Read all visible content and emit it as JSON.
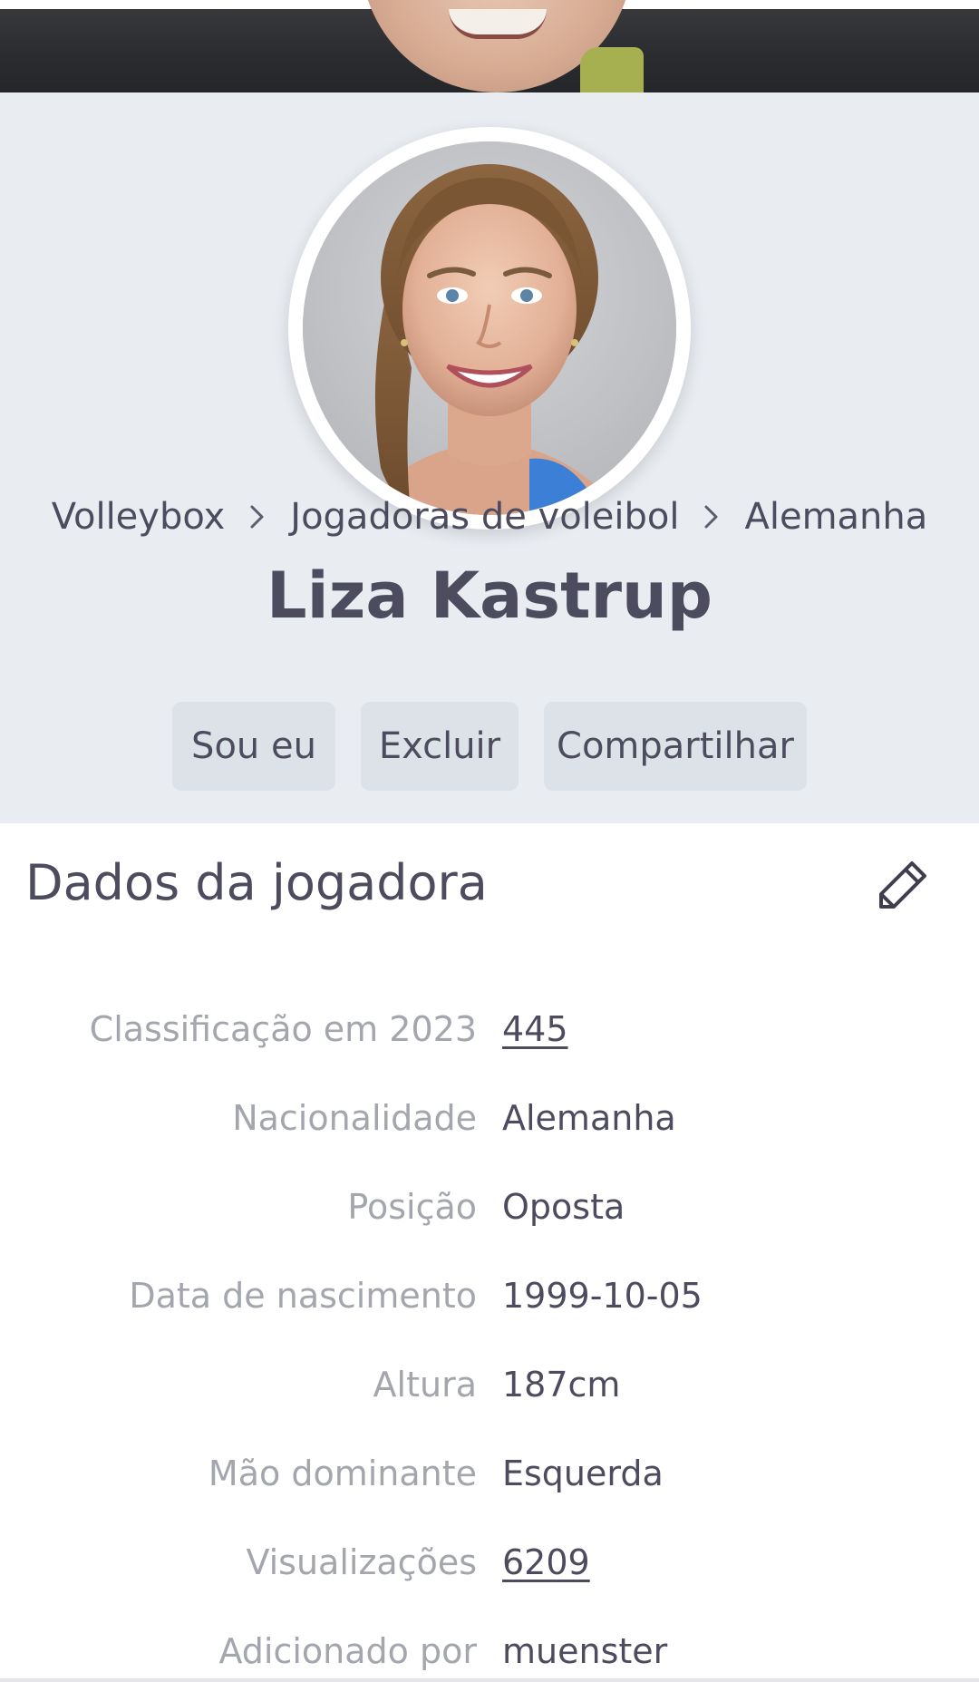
{
  "breadcrumb": {
    "items": [
      "Volleybox",
      "Jogadoras de voleibol",
      "Alemanha"
    ]
  },
  "player": {
    "name": "Liza Kastrup"
  },
  "actions": {
    "claim": "Sou eu",
    "delete": "Excluir",
    "share": "Compartilhar"
  },
  "data_section": {
    "title": "Dados da jogadora",
    "rows": [
      {
        "label": "Classificação em 2023",
        "value": "445"
      },
      {
        "label": "Nacionalidade",
        "value": "Alemanha"
      },
      {
        "label": "Posição",
        "value": "Oposta"
      },
      {
        "label": "Data de nascimento",
        "value": "1999-10-05"
      },
      {
        "label": "Altura",
        "value": "187cm"
      },
      {
        "label": "Mão dominante",
        "value": "Esquerda"
      },
      {
        "label": "Visualizações",
        "value": "6209"
      },
      {
        "label": "Adicionado por",
        "value": "muenster"
      }
    ]
  },
  "icons": {
    "breadcrumb_separator": "chevron-right-icon",
    "edit": "pencil-icon"
  },
  "colors": {
    "header_bg": "#e9edf2",
    "button_bg": "#dde2e8",
    "text": "#4d4c5e",
    "label": "#a3a6ad"
  }
}
